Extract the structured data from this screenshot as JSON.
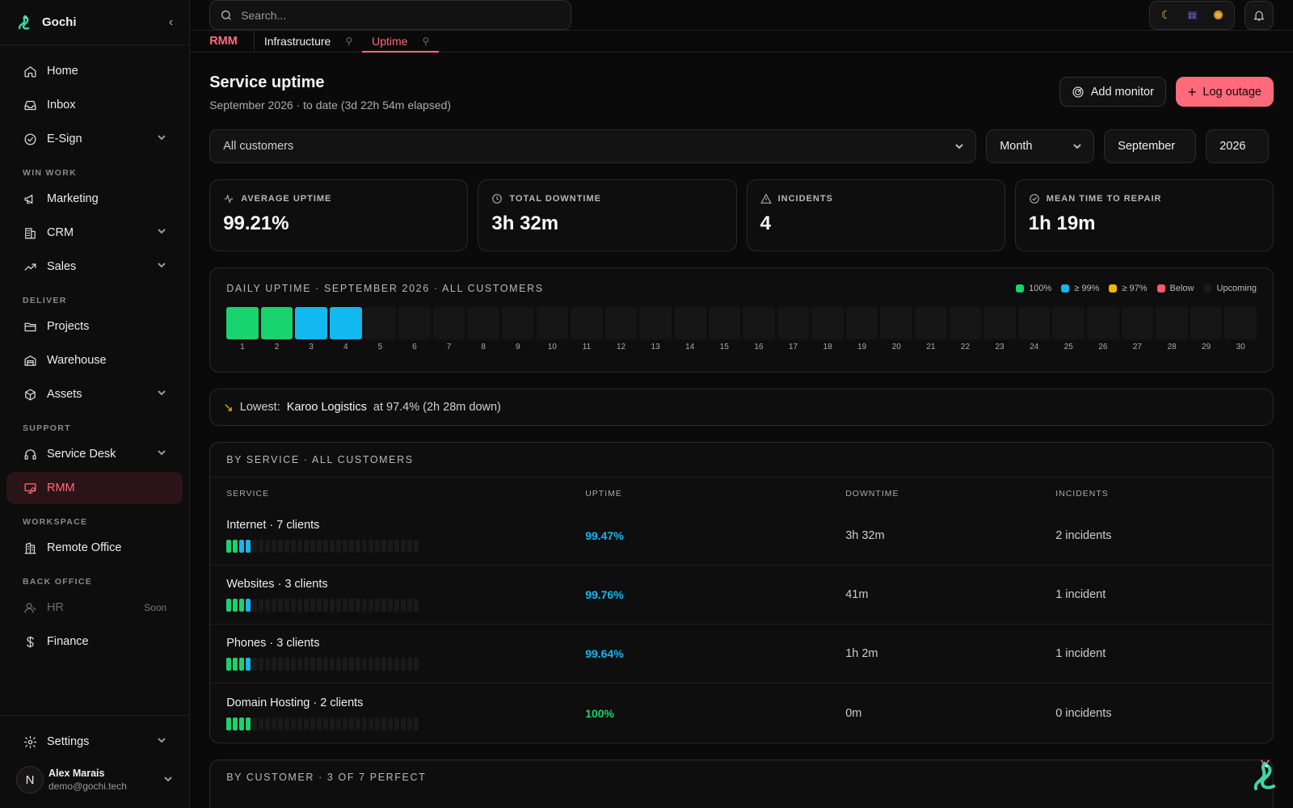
{
  "brand": {
    "name": "Gochi"
  },
  "sidebar": {
    "top_items": [
      {
        "label": "Home",
        "icon": "home-icon"
      },
      {
        "label": "Inbox",
        "icon": "inbox-icon"
      },
      {
        "label": "E-Sign",
        "icon": "check-circle-icon",
        "expandable": true
      }
    ],
    "sections": [
      {
        "title": "WIN WORK",
        "items": [
          {
            "label": "Marketing",
            "icon": "megaphone-icon"
          },
          {
            "label": "CRM",
            "icon": "building-icon",
            "expandable": true
          },
          {
            "label": "Sales",
            "icon": "trend-up-icon",
            "expandable": true
          }
        ]
      },
      {
        "title": "DELIVER",
        "items": [
          {
            "label": "Projects",
            "icon": "folder-icon"
          },
          {
            "label": "Warehouse",
            "icon": "warehouse-icon"
          },
          {
            "label": "Assets",
            "icon": "box-icon",
            "expandable": true
          }
        ]
      },
      {
        "title": "SUPPORT",
        "items": [
          {
            "label": "Service Desk",
            "icon": "headset-icon",
            "expandable": true
          },
          {
            "label": "RMM",
            "icon": "monitor-icon",
            "active": true
          }
        ]
      },
      {
        "title": "WORKSPACE",
        "items": [
          {
            "label": "Remote Office",
            "icon": "office-icon"
          }
        ]
      },
      {
        "title": "BACK OFFICE",
        "items": [
          {
            "label": "HR",
            "icon": "user-icon",
            "disabled": true,
            "badge": "Soon"
          },
          {
            "label": "Finance",
            "icon": "dollar-icon"
          }
        ]
      }
    ],
    "settings_label": "Settings",
    "user": {
      "initial": "N",
      "name": "Alex Marais",
      "email": "demo@gochi.tech"
    }
  },
  "topbar": {
    "search_placeholder": "Search..."
  },
  "tabs": {
    "module": "RMM",
    "items": [
      {
        "label": "Infrastructure",
        "active": false
      },
      {
        "label": "Uptime",
        "active": true
      }
    ]
  },
  "page": {
    "title": "Service uptime",
    "subtitle": "September 2026 · to date (3d 22h 54m elapsed)",
    "add_monitor": "Add monitor",
    "log_outage": "Log outage"
  },
  "filters": {
    "customer": "All customers",
    "period": "Month",
    "month": "September",
    "year": "2026"
  },
  "stats": [
    {
      "label": "AVERAGE UPTIME",
      "value": "99.21%",
      "icon": "activity-icon"
    },
    {
      "label": "TOTAL DOWNTIME",
      "value": "3h 32m",
      "icon": "clock-icon"
    },
    {
      "label": "INCIDENTS",
      "value": "4",
      "icon": "warning-icon"
    },
    {
      "label": "MEAN TIME TO REPAIR",
      "value": "1h 19m",
      "icon": "check-circle-icon"
    }
  ],
  "daily": {
    "title": "DAILY UPTIME · SEPTEMBER 2026 · ALL CUSTOMERS",
    "legend": [
      {
        "label": "100%",
        "color": "#19d36e"
      },
      {
        "label": "≥ 99%",
        "color": "#12b8f0"
      },
      {
        "label": "≥ 97%",
        "color": "#f5b400"
      },
      {
        "label": "Below",
        "color": "#ff5a67"
      },
      {
        "label": "Upcoming",
        "color": "#1a1a1a"
      }
    ],
    "days": [
      "full",
      "full",
      "high",
      "high",
      "up",
      "up",
      "up",
      "up",
      "up",
      "up",
      "up",
      "up",
      "up",
      "up",
      "up",
      "up",
      "up",
      "up",
      "up",
      "up",
      "up",
      "up",
      "up",
      "up",
      "up",
      "up",
      "up",
      "up",
      "up",
      "up"
    ]
  },
  "lowest": {
    "label": "Lowest:",
    "customer": "Karoo Logistics",
    "detail": "at 97.4% (2h 28m down)"
  },
  "by_service": {
    "title": "BY SERVICE · ALL CUSTOMERS",
    "columns": [
      "SERVICE",
      "UPTIME",
      "DOWNTIME",
      "INCIDENTS"
    ],
    "rows": [
      {
        "name": "Internet · 7 clients",
        "uptime": "99.47%",
        "downtime": "3h 32m",
        "incidents": "2 incidents",
        "bars": [
          "full",
          "full",
          "high",
          "high"
        ],
        "level": "high"
      },
      {
        "name": "Websites · 3 clients",
        "uptime": "99.76%",
        "downtime": "41m",
        "incidents": "1 incident",
        "bars": [
          "full",
          "full",
          "full",
          "high"
        ],
        "level": "high"
      },
      {
        "name": "Phones · 3 clients",
        "uptime": "99.64%",
        "downtime": "1h 2m",
        "incidents": "1 incident",
        "bars": [
          "full",
          "full",
          "full",
          "high"
        ],
        "level": "high"
      },
      {
        "name": "Domain Hosting · 2 clients",
        "uptime": "100%",
        "downtime": "0m",
        "incidents": "0 incidents",
        "bars": [
          "full",
          "full",
          "full",
          "full"
        ],
        "level": "full"
      }
    ]
  },
  "by_customer": {
    "title": "BY CUSTOMER · 3 OF 7 PERFECT"
  },
  "colors": {
    "accent": "#ff6b7a",
    "full": "#19d36e",
    "high": "#12b8f0",
    "upcoming": "#161616"
  }
}
